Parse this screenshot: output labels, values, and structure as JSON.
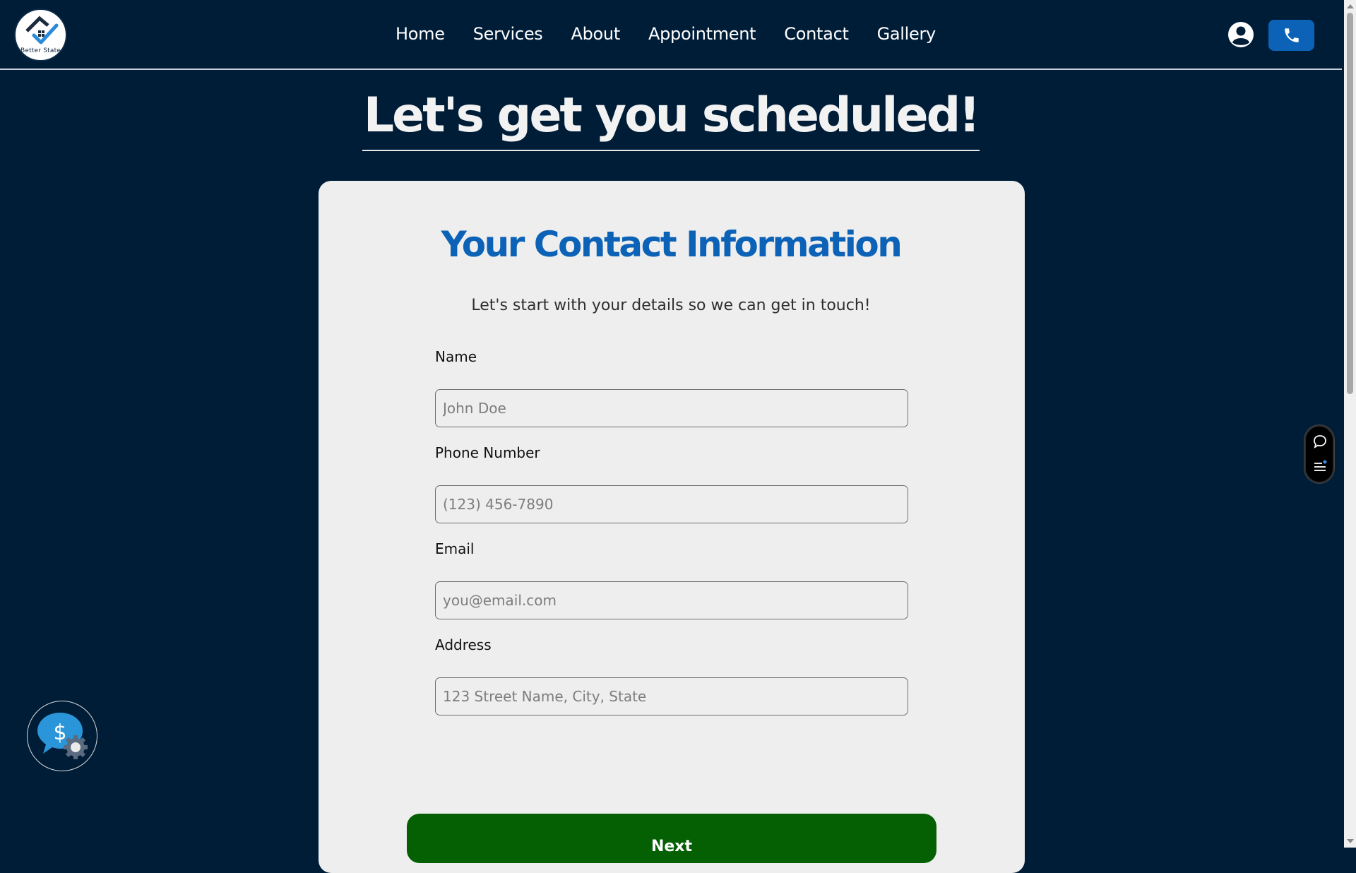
{
  "header": {
    "logo_text": "Better State",
    "nav": [
      {
        "label": "Home"
      },
      {
        "label": "Services"
      },
      {
        "label": "About"
      },
      {
        "label": "Appointment"
      },
      {
        "label": "Contact"
      },
      {
        "label": "Gallery"
      }
    ],
    "user_icon": "user-circle-icon",
    "phone_icon": "phone-icon"
  },
  "page": {
    "title": "Let's get you scheduled!"
  },
  "form": {
    "title": "Your Contact Information",
    "subtitle": "Let's start with your details so we can get in touch!",
    "fields": [
      {
        "label": "Name",
        "placeholder": "John Doe",
        "value": ""
      },
      {
        "label": "Phone Number",
        "placeholder": "(123) 456-7890",
        "value": ""
      },
      {
        "label": "Email",
        "placeholder": "you@email.com",
        "value": ""
      },
      {
        "label": "Address",
        "placeholder": "123 Street Name, City, State",
        "value": ""
      }
    ],
    "next_label": "Next"
  },
  "widgets": {
    "pricing_icon": "dollar-chat-gear-icon",
    "side_icons": [
      "chat-bubble-icon",
      "menu-list-icon"
    ]
  },
  "colors": {
    "background": "#001d38",
    "accent_blue": "#0b62b6",
    "card": "#eeeeee",
    "next_button": "#056004"
  }
}
